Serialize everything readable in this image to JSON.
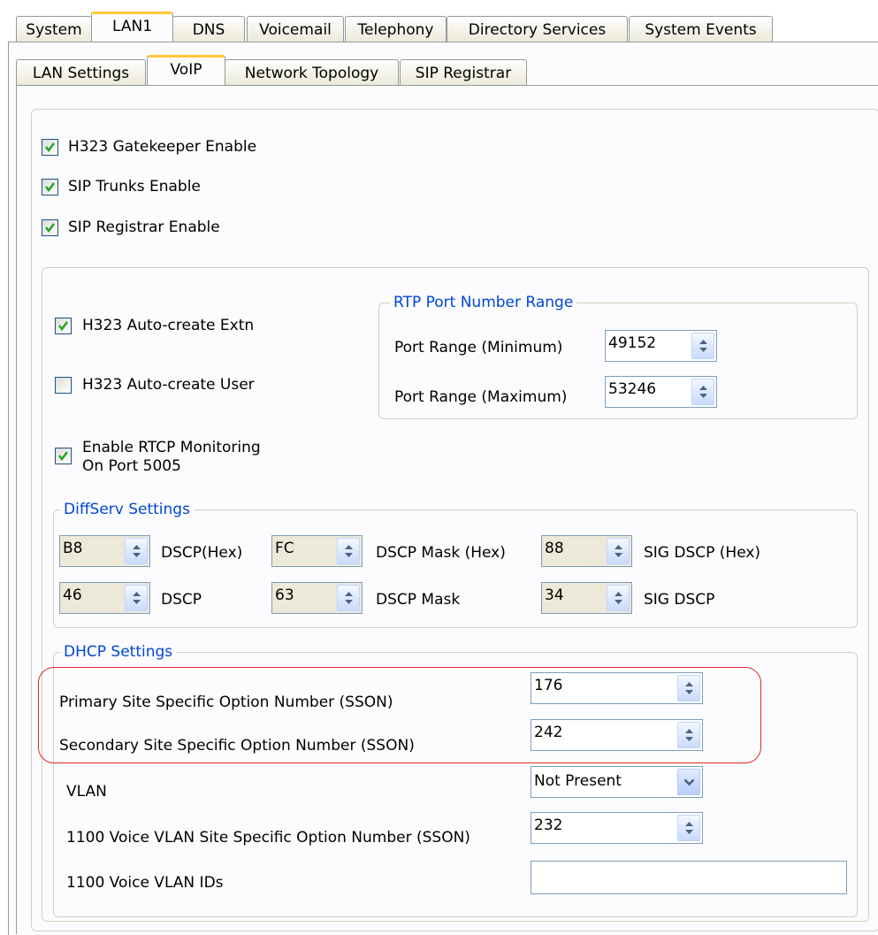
{
  "top_tabs": [
    "System",
    "LAN1",
    "DNS",
    "Voicemail",
    "Telephony",
    "Directory Services",
    "System Events"
  ],
  "sub_tabs": [
    "LAN Settings",
    "VoIP",
    "Network Topology",
    "SIP Registrar"
  ],
  "enables": {
    "h323_gatekeeper": "H323 Gatekeeper Enable",
    "sip_trunks": "SIP Trunks Enable",
    "sip_registrar": "SIP Registrar Enable"
  },
  "auto_create": {
    "extn": "H323 Auto-create Extn",
    "user": "H323 Auto-create User",
    "rtcp_line1": "Enable RTCP Monitoring",
    "rtcp_line2": "On Port 5005"
  },
  "rtp": {
    "title": "RTP Port Number Range",
    "min_label": "Port Range (Minimum)",
    "min_value": "49152",
    "max_label": "Port Range (Maximum)",
    "max_value": "53246"
  },
  "diffserv": {
    "title": "DiffServ Settings",
    "dscp_hex": "B8",
    "dscp_hex_label": "DSCP(Hex)",
    "mask_hex": "FC",
    "mask_hex_label": "DSCP Mask (Hex)",
    "sig_hex": "88",
    "sig_hex_label": "SIG DSCP (Hex)",
    "dscp": "46",
    "dscp_label": "DSCP",
    "mask": "63",
    "mask_label": "DSCP Mask",
    "sig": "34",
    "sig_label": "SIG DSCP"
  },
  "dhcp": {
    "title": "DHCP Settings",
    "primary_label": "Primary Site Specific Option Number (SSON)",
    "primary_value": "176",
    "secondary_label": "Secondary Site Specific Option Number (SSON)",
    "secondary_value": "242",
    "vlan_label": "VLAN",
    "vlan_value": "Not Present",
    "voice_vlan_sson_label": "1100 Voice VLAN Site Specific Option Number (SSON)",
    "voice_vlan_sson_value": "232",
    "voice_vlan_ids_label": "1100 Voice VLAN IDs",
    "voice_vlan_ids_value": ""
  },
  "colors": {
    "legend": "#0046d5",
    "active_tab_accent": "#ffc83c",
    "highlight": "#e02a2a"
  }
}
